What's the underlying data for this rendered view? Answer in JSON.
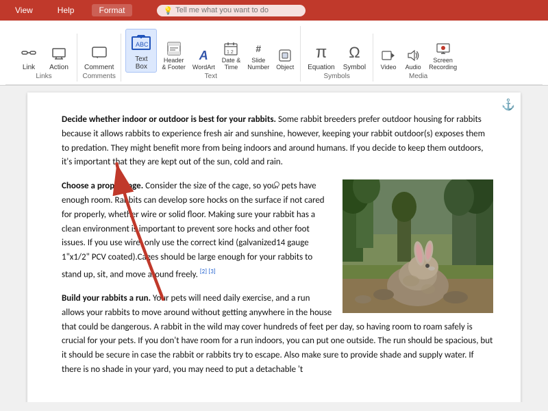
{
  "topbar": {
    "tabs": [
      "View",
      "Help",
      "Format"
    ],
    "active_tab": "Format",
    "tell_me": {
      "placeholder": "Tell me what you want to do",
      "icon": "💡"
    }
  },
  "ribbon": {
    "groups": [
      {
        "id": "links",
        "label": "Links",
        "items": [
          {
            "id": "link",
            "icon": "🔗",
            "label": "Link",
            "large": true
          },
          {
            "id": "action",
            "icon": "⚡",
            "label": "Action",
            "large": true
          }
        ]
      },
      {
        "id": "comments",
        "label": "Comments",
        "items": [
          {
            "id": "comment",
            "icon": "💬",
            "label": "Comment",
            "large": true
          }
        ]
      },
      {
        "id": "text",
        "label": "Text",
        "items": [
          {
            "id": "textbox",
            "icon": "▣",
            "label": "Text\nBox",
            "large": true,
            "active": true
          },
          {
            "id": "header-footer",
            "icon": "≡",
            "label": "Header\n& Footer",
            "large": false
          },
          {
            "id": "wordart",
            "icon": "A",
            "label": "WordArt",
            "large": false
          },
          {
            "id": "datetime",
            "icon": "📅",
            "label": "Date &\nTime",
            "large": false
          },
          {
            "id": "slide-number",
            "icon": "#",
            "label": "Slide\nNumber",
            "large": false
          },
          {
            "id": "object",
            "icon": "⬡",
            "label": "Object",
            "large": false
          }
        ]
      },
      {
        "id": "symbols",
        "label": "Symbols",
        "items": [
          {
            "id": "equation",
            "icon": "π",
            "label": "Equation",
            "large": true
          },
          {
            "id": "symbol",
            "icon": "Ω",
            "label": "Symbol",
            "large": true
          }
        ]
      },
      {
        "id": "media",
        "label": "Media",
        "items": [
          {
            "id": "video",
            "icon": "▶",
            "label": "Video",
            "large": false
          },
          {
            "id": "audio",
            "icon": "🔊",
            "label": "Audio",
            "large": false
          },
          {
            "id": "screen-recording",
            "icon": "⬛",
            "label": "Screen\nRecording",
            "large": false
          }
        ]
      }
    ]
  },
  "document": {
    "paragraphs": [
      {
        "id": "para1",
        "bold_start": "Decide whether indoor or outdoor is best for your rabbits.",
        "text": " Some rabbit breeders prefer outdoor housing for rabbits because it allows rabbits to experience fresh air and sunshine, however, keeping your rabbit outdoor(s) exposes them to predation. They might benefit more from being indoors and around humans. If you decide to keep them outdoors, it's important that they are kept out of the sun, cold and rain."
      },
      {
        "id": "para2",
        "bold_start": "Choose a proper cage.",
        "text": " Consider the size of the cage, so your pets have enough room. Rabbits can develop sore hocks on the surface if not cared for properly, whether wire or solid floor. Making sure your rabbit has a clean environment is important to prevent sore hocks and other foot issues. If you use wire, only use the correct kind (galvanized14 gauge 1\"x1/2\" PCV coated).Cages should be large enough for your rabbits to stand up, sit, and move around freely.",
        "footnotes": [
          "[2]",
          "[3]"
        ],
        "has_image": true
      },
      {
        "id": "para3",
        "bold_start": "Build your rabbits a run.",
        "text": " Your pets will need daily exercise, and a run allows your rabbits to move around without getting anywhere in the house that could be dangerous. A rabbit in the wild may cover hundreds of feet per day, so having room to roam safely is crucial for your pets. If you don't have room for a run indoors, you can put one outside. The run should be spacious, but it should be secure in case the rabbit or rabbits try to escape. Also make sure to provide shade and supply water. If there is no shade in your yard, you may need to put a detachable 't"
      }
    ]
  },
  "arrow": {
    "color": "#c0392b",
    "points_to": "textbox_button"
  }
}
